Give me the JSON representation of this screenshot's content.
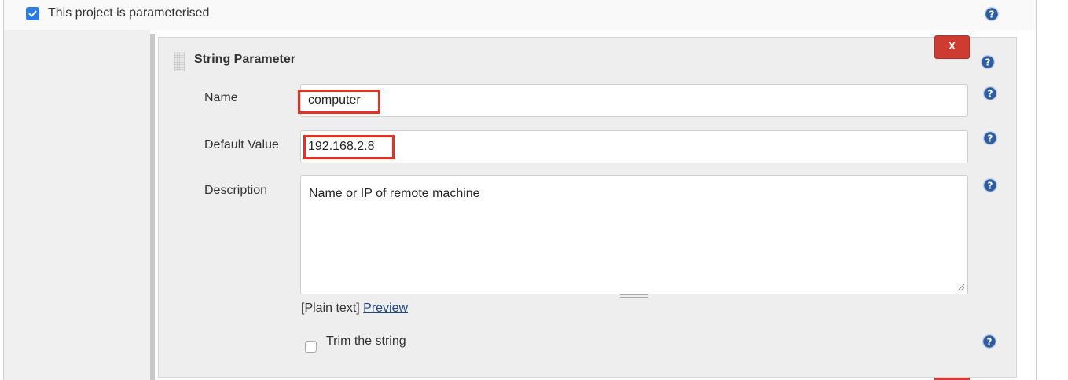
{
  "project": {
    "parameterised_label": "This project is parameterised",
    "parameterised_checked": true
  },
  "parameter": {
    "type_title": "String Parameter",
    "delete_label": "X",
    "fields": {
      "name_label": "Name",
      "name_value": "computer",
      "default_label": "Default Value",
      "default_value": "192.168.2.8",
      "description_label": "Description",
      "description_value": "Name or IP of remote machine"
    },
    "markup": {
      "prefix": "[Plain text]",
      "preview_link": "Preview"
    },
    "trim": {
      "label": "Trim the string",
      "checked": false
    }
  },
  "icons": {
    "help": "help-icon",
    "grip": "drag-handle-icon",
    "resize": "resize-handle-icon",
    "checkmark": "checkmark-icon"
  },
  "colors": {
    "accent": "#2b7be4",
    "delete": "#cf3a31",
    "highlight": "#e3321f",
    "link": "#204a87"
  }
}
